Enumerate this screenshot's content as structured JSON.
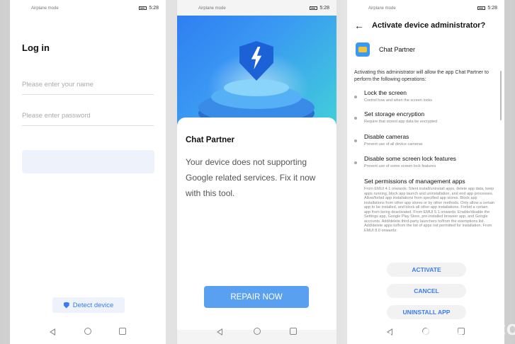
{
  "status": {
    "left_text": "Airplane mode",
    "time": "5:28"
  },
  "login_screen": {
    "title": "Log in",
    "username_placeholder": "Please enter your name",
    "password_placeholder": "Please enter password",
    "detect_device_label": "Detect device"
  },
  "repair_screen": {
    "app_name": "Chat Partner",
    "message": "Your device does not supporting Google related services. Fix it now with this tool.",
    "repair_label": "REPAIR NOW"
  },
  "admin_screen": {
    "title": "Activate device administrator?",
    "app_name": "Chat Partner",
    "intro": "Activating this administrator will allow the app Chat Partner to perform the following operations:",
    "permissions": [
      {
        "title": "Lock the screen",
        "desc": "Control how and when the screen locks"
      },
      {
        "title": "Set storage encryption",
        "desc": "Require that stored app data be encrypted"
      },
      {
        "title": "Disable cameras",
        "desc": "Prevent use of all device cameras"
      },
      {
        "title": "Disable some screen lock features",
        "desc": "Prevent use of some screen lock features"
      },
      {
        "title": "Set permissions of management apps",
        "desc": "From EMUI 4.1 onwards: Silent install/uninstall apps, delete app data, keep apps running, block app launch and uninstallation, and end app processes. Allow/forbid app installations from specified app stores. Block app installations from other app stores or by other methods. Only allow a certain app to be installed, and block all other app installations. Forbid a certain app from being deactivated. From EMUI 5.1 onwards: Enable/disable the Settings app, Google Play Store, pre-installed browser app, and Google accounts. Add/delete third-party launchers to/from the exemptions list. Add/delete apps to/from the list of apps not permitted for installation. From EMUI 8.0 onwards:"
      }
    ],
    "activate_label": "ACTIVATE",
    "cancel_label": "CANCEL",
    "uninstall_label": "UNINSTALL APP"
  },
  "watermark": "TECHNOCALIBT.COM",
  "colors": {
    "accent": "#3a7cf5",
    "repair_button": "#5aa0f0"
  }
}
